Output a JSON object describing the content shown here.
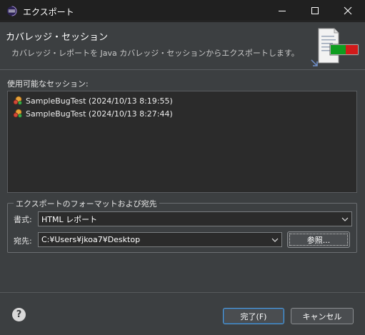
{
  "window": {
    "title": "エクスポート",
    "controls": {
      "minimize": "minimize-icon",
      "maximize": "maximize-icon",
      "close": "close-icon"
    }
  },
  "header": {
    "title": "カバレッジ・セッション",
    "description": "カバレッジ・レポートを Java カバレッジ・セッションからエクスポートします。",
    "icon": "export-report-icon"
  },
  "sessions": {
    "label": "使用可能なセッション:",
    "items": [
      {
        "label": "SampleBugTest (2024/10/13 8:19:55)",
        "icon": "coverage-session-icon"
      },
      {
        "label": "SampleBugTest (2024/10/13 8:27:44)",
        "icon": "coverage-session-icon"
      }
    ]
  },
  "format_group": {
    "legend": "エクスポートのフォーマットおよび宛先",
    "format_label": "書式:",
    "format_value": "HTML レポート",
    "dest_label": "宛先:",
    "dest_value": "C:¥Users¥jkoa7¥Desktop",
    "browse_label": "参照..."
  },
  "footer": {
    "help_icon": "help-icon",
    "help_glyph": "?",
    "finish_label": "完了(F)",
    "cancel_label": "キャンセル"
  },
  "colors": {
    "background": "#3c3f41",
    "list_background": "#2b2b2b",
    "primary_border": "#5a9bd5",
    "title_bar": "#202020"
  }
}
